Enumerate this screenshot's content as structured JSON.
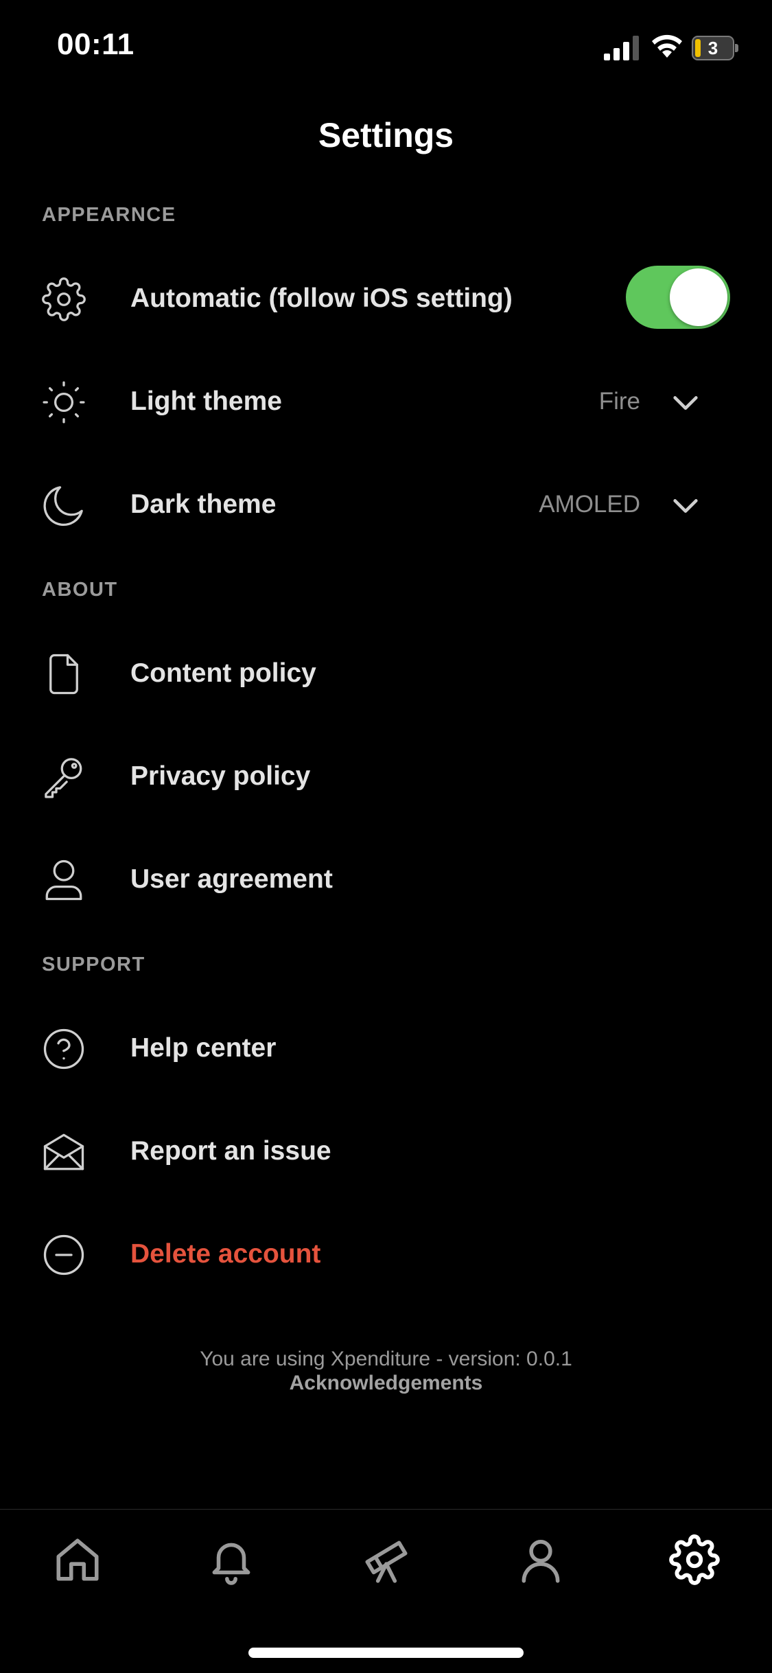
{
  "status": {
    "time": "00:11",
    "battery": "3"
  },
  "header": {
    "title": "Settings"
  },
  "sections": {
    "appearance": "APPEARNCE",
    "about": "ABOUT",
    "support": "SUPPORT"
  },
  "appearance": {
    "automatic": {
      "label": "Automatic (follow iOS setting)",
      "enabled": true,
      "toggle_color": "#5fc75c"
    },
    "light_theme": {
      "label": "Light theme",
      "value": "Fire"
    },
    "dark_theme": {
      "label": "Dark theme",
      "value": "AMOLED"
    }
  },
  "about": {
    "content_policy": "Content policy",
    "privacy_policy": "Privacy policy",
    "user_agreement": "User agreement"
  },
  "support": {
    "help_center": "Help center",
    "report_issue": "Report an issue",
    "delete_account": "Delete account",
    "delete_color": "#e5533d"
  },
  "footer": {
    "version_text": "You are using Xpenditure - version: 0.0.1",
    "acknowledgements": "Acknowledgements"
  },
  "tabbar": {
    "items": [
      {
        "icon": "home-icon",
        "active": false
      },
      {
        "icon": "bell-icon",
        "active": false
      },
      {
        "icon": "telescope-icon",
        "active": false
      },
      {
        "icon": "person-icon",
        "active": false
      },
      {
        "icon": "gear-icon",
        "active": true
      }
    ]
  }
}
